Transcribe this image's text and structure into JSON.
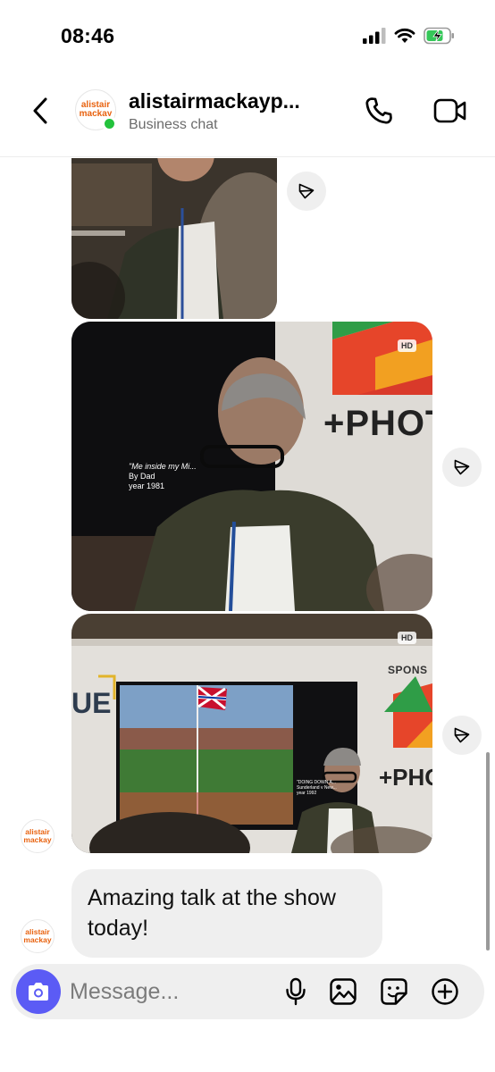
{
  "status_bar": {
    "time": "08:46",
    "icons": [
      "cellular-signal-icon",
      "wifi-icon",
      "battery-charging-icon"
    ]
  },
  "header": {
    "contact_name": "alistairmackayp...",
    "subtitle": "Business chat",
    "avatar_text_line1": "alistair",
    "avatar_text_line2": "mackay",
    "online_color": "#23c23c",
    "icons": [
      "back-chevron-icon",
      "phone-icon",
      "video-camera-icon"
    ]
  },
  "photo_slide": {
    "line1": "\"Me inside my Mi...",
    "line2": "By Dad",
    "line3": "year 1981",
    "sign_text": "+PHOT"
  },
  "photo_stage": {
    "sign_left": "UE",
    "sponsor_text": "SPONS",
    "sign_text": "+PHOT",
    "screen_caption": "\"DOING DOWN A...",
    "screen_caption2": "Sunderland v New...",
    "screen_caption3": "year 1992"
  },
  "messages": {
    "hd_label": "HD",
    "text_message": "Amazing talk at the show today!",
    "sender_avatar_line1": "alistair",
    "sender_avatar_line2": "mackay"
  },
  "composer": {
    "placeholder": "Message...",
    "icons": [
      "camera-icon",
      "microphone-icon",
      "gallery-icon",
      "sticker-icon",
      "plus-icon"
    ],
    "accent_color": "#5b5bf5"
  }
}
